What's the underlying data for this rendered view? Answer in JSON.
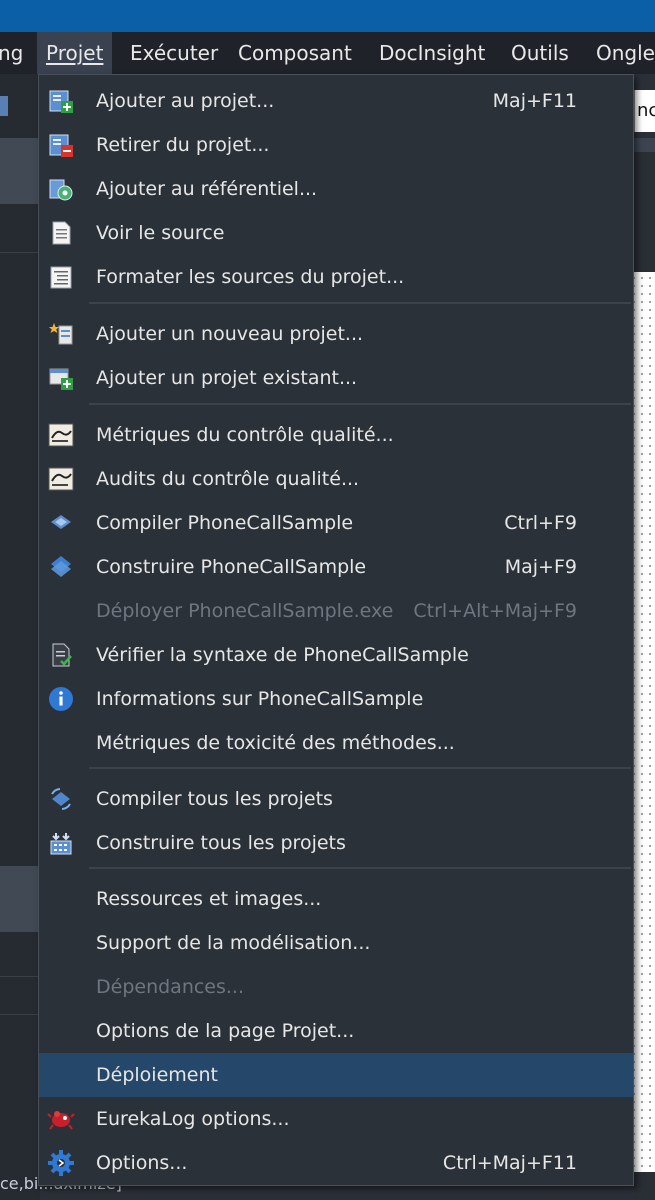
{
  "menubar": {
    "items": [
      {
        "label": "ng"
      },
      {
        "label": "Projet"
      },
      {
        "label": "Exécuter"
      },
      {
        "label": "Composant"
      },
      {
        "label": "DocInsight"
      },
      {
        "label": "Outils"
      },
      {
        "label": "Onglet"
      }
    ]
  },
  "background": {
    "right_tab_text": "nc",
    "status_fragment": "ce,bi...aximize]"
  },
  "menu": {
    "items": [
      {
        "label": "Ajouter au projet...",
        "shortcut": "Maj+F11",
        "icon": "add-to-project-icon"
      },
      {
        "label": "Retirer du projet...",
        "shortcut": "",
        "icon": "remove-from-project-icon"
      },
      {
        "label": "Ajouter au référentiel...",
        "shortcut": "",
        "icon": "add-to-repository-icon"
      },
      {
        "label": "Voir le source",
        "shortcut": "",
        "icon": "view-source-icon"
      },
      {
        "label": "Formater les sources du projet...",
        "shortcut": "",
        "icon": "format-sources-icon"
      },
      {
        "label": "Ajouter un nouveau projet...",
        "shortcut": "",
        "icon": "new-project-icon"
      },
      {
        "label": "Ajouter un projet existant...",
        "shortcut": "",
        "icon": "existing-project-icon"
      },
      {
        "label": "Métriques du contrôle qualité...",
        "shortcut": "",
        "icon": "qa-metrics-icon"
      },
      {
        "label": "Audits du contrôle qualité...",
        "shortcut": "",
        "icon": "qa-audits-icon"
      },
      {
        "label": "Compiler PhoneCallSample",
        "shortcut": "Ctrl+F9",
        "icon": "compile-icon"
      },
      {
        "label": "Construire PhoneCallSample",
        "shortcut": "Maj+F9",
        "icon": "build-icon"
      },
      {
        "label": "Déployer PhoneCallSample.exe",
        "shortcut": "Ctrl+Alt+Maj+F9",
        "icon": ""
      },
      {
        "label": "Vérifier la syntaxe de PhoneCallSample",
        "shortcut": "",
        "icon": "syntax-check-icon"
      },
      {
        "label": "Informations sur PhoneCallSample",
        "shortcut": "",
        "icon": "info-icon"
      },
      {
        "label": "Métriques de toxicité des méthodes...",
        "shortcut": "",
        "icon": ""
      },
      {
        "label": "Compiler tous les projets",
        "shortcut": "",
        "icon": "compile-all-icon"
      },
      {
        "label": "Construire tous les projets",
        "shortcut": "",
        "icon": "build-all-icon"
      },
      {
        "label": "Ressources et images...",
        "shortcut": "",
        "icon": ""
      },
      {
        "label": "Support de la modélisation...",
        "shortcut": "",
        "icon": ""
      },
      {
        "label": "Dépendances...",
        "shortcut": "",
        "icon": ""
      },
      {
        "label": "Options de la page Projet...",
        "shortcut": "",
        "icon": ""
      },
      {
        "label": "Déploiement",
        "shortcut": "",
        "icon": ""
      },
      {
        "label": "EurekaLog options...",
        "shortcut": "",
        "icon": "eurekalog-icon"
      },
      {
        "label": "Options...",
        "shortcut": "Ctrl+Maj+F11",
        "icon": "options-gear-icon"
      }
    ],
    "disabled_items": [
      "Déployer PhoneCallSample.exe",
      "Dépendances..."
    ],
    "highlighted_item": "Déploiement"
  },
  "colors": {
    "menu_background": "#2b3138",
    "highlight": "#24476a",
    "disabled_text": "#6f7680",
    "titlebar": "#0a5fa6"
  }
}
